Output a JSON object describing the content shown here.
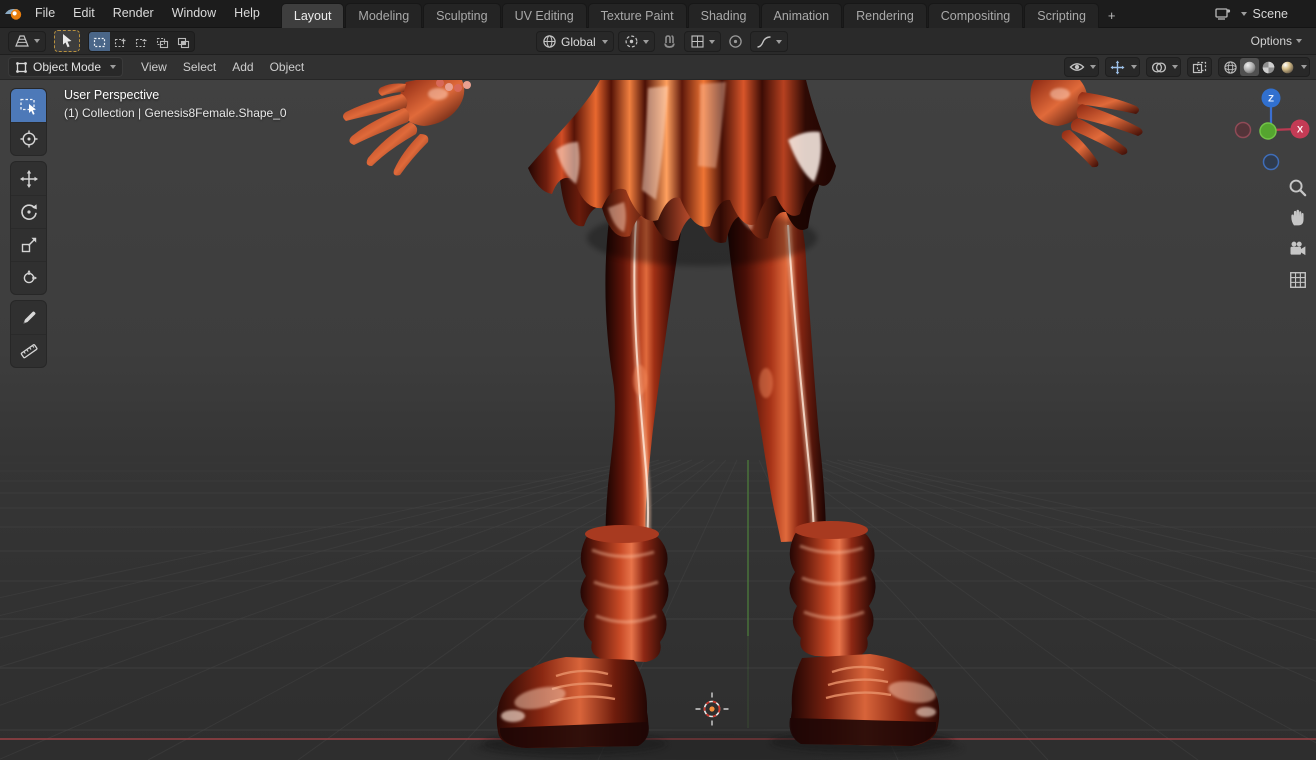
{
  "topbar": {
    "menus": [
      "File",
      "Edit",
      "Render",
      "Window",
      "Help"
    ],
    "tabs": [
      "Layout",
      "Modeling",
      "Sculpting",
      "UV Editing",
      "Texture Paint",
      "Shading",
      "Animation",
      "Rendering",
      "Compositing",
      "Scripting"
    ],
    "add_tab_label": "+",
    "scene_name": "Scene"
  },
  "tool_settings": {
    "orientation_label": "Global",
    "options_label": "Options"
  },
  "viewport_header": {
    "mode_label": "Object Mode",
    "menus": [
      "View",
      "Select",
      "Add",
      "Object"
    ]
  },
  "viewport_overlay": {
    "view_label": "User Perspective",
    "context_label": "(1) Collection | Genesis8Female.Shape_0"
  },
  "nav_gizmo": {
    "x_label": "X",
    "z_label": "Z"
  },
  "colors": {
    "accent_blue": "#4772b3",
    "axis_x_red": "#c43b55",
    "axis_y_green": "#55a52f",
    "axis_z_blue": "#3170cf",
    "model_red": "#b03a1c"
  }
}
